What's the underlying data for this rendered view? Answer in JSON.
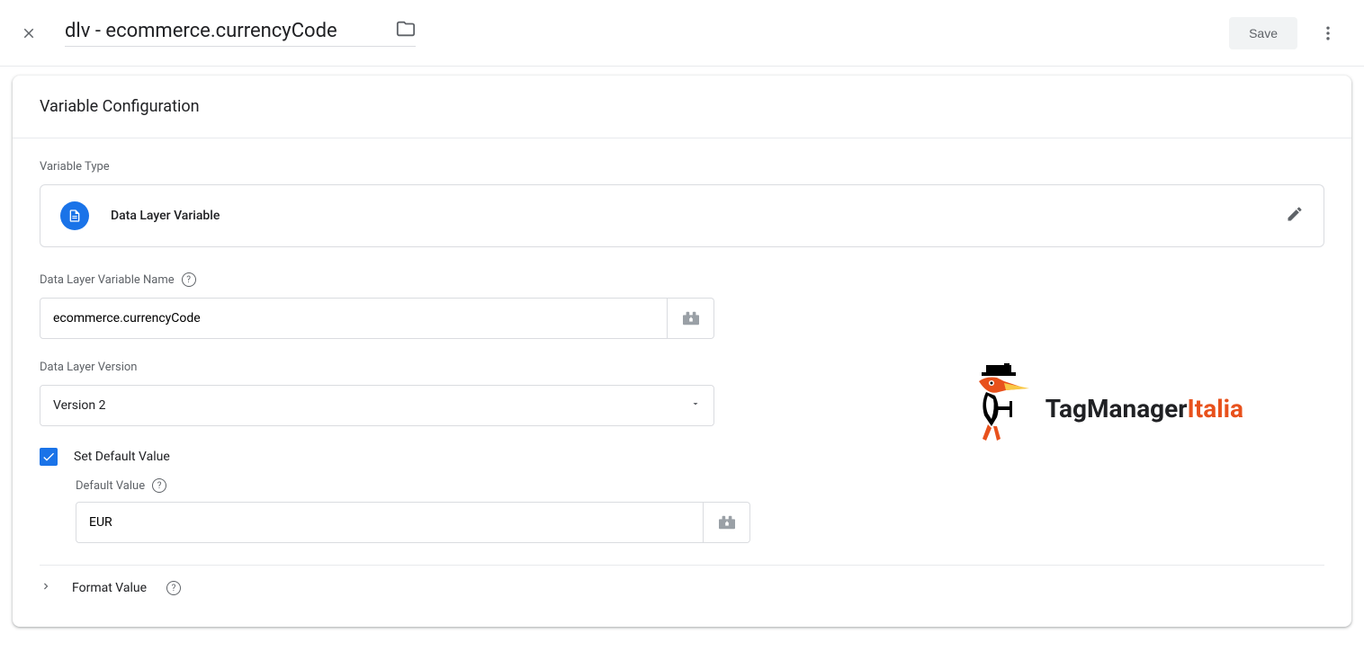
{
  "header": {
    "title": "dlv - ecommerce.currencyCode",
    "save_label": "Save"
  },
  "config": {
    "section_title": "Variable Configuration",
    "type_label": "Variable Type",
    "type_name": "Data Layer Variable",
    "var_name_label": "Data Layer Variable Name",
    "var_name_value": "ecommerce.currencyCode",
    "version_label": "Data Layer Version",
    "version_value": "Version 2",
    "set_default_label": "Set Default Value",
    "set_default_checked": true,
    "default_value_label": "Default Value",
    "default_value": "EUR",
    "format_label": "Format Value"
  },
  "watermark": {
    "text1": "TagManager",
    "text2": "Italia"
  }
}
